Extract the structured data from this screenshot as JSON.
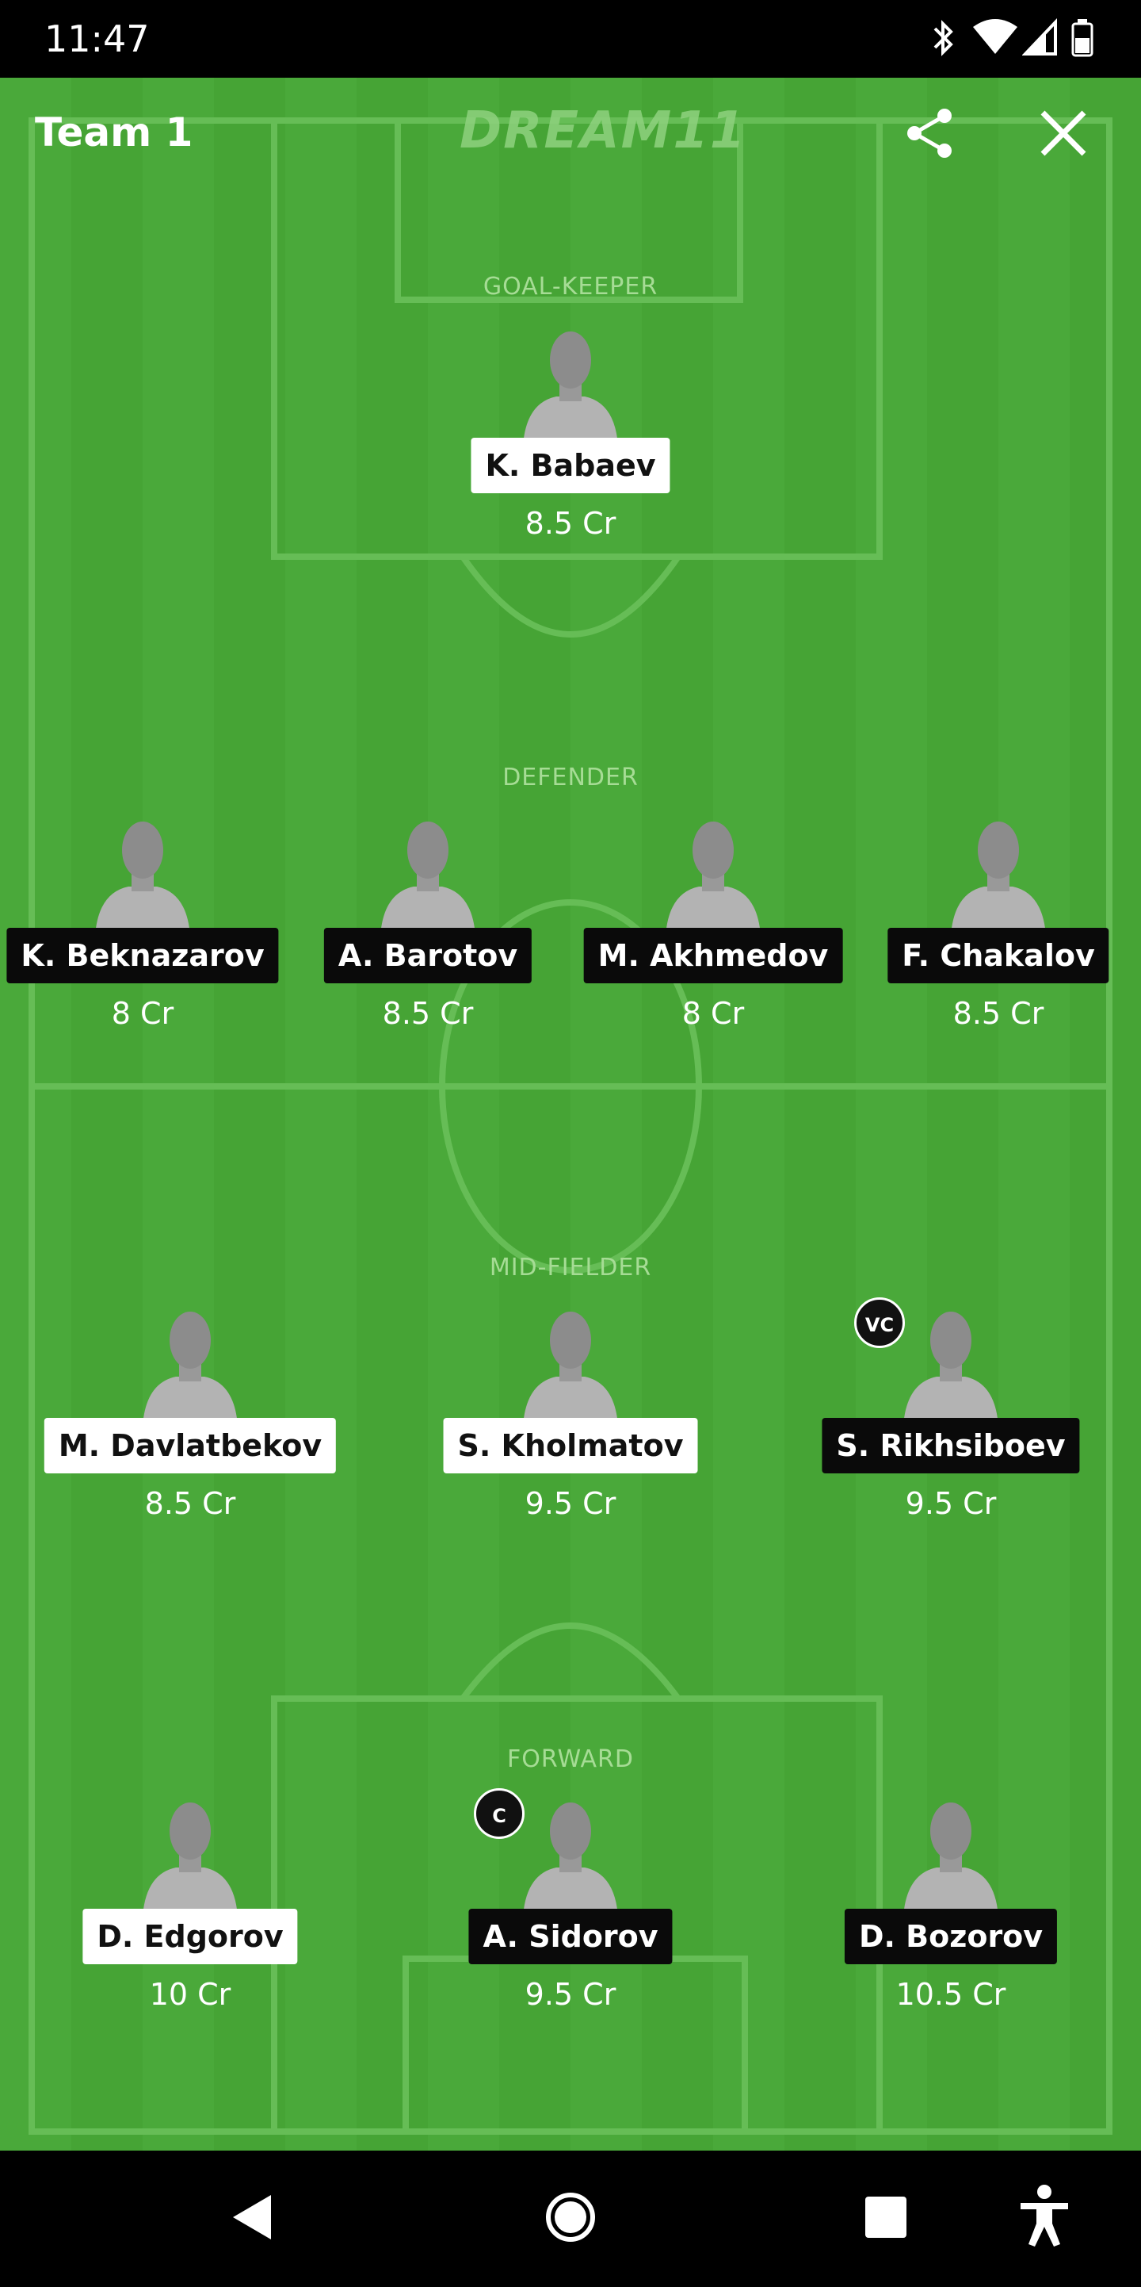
{
  "status_bar": {
    "time": "11:47"
  },
  "header": {
    "title": "Team 1",
    "brand": "DREAM11"
  },
  "sections": {
    "goalkeeper": "GOAL-KEEPER",
    "defender": "DEFENDER",
    "midfielder": "MID-FIELDER",
    "forward": "FORWARD"
  },
  "players": {
    "gk1": {
      "name": "K. Babaev",
      "credits": "8.5 Cr",
      "style": "light"
    },
    "def1": {
      "name": "K. Beknazarov",
      "credits": "8 Cr",
      "style": "dark"
    },
    "def2": {
      "name": "A. Barotov",
      "credits": "8.5 Cr",
      "style": "dark"
    },
    "def3": {
      "name": "M. Akhmedov",
      "credits": "8 Cr",
      "style": "dark"
    },
    "def4": {
      "name": "F. Chakalov",
      "credits": "8.5 Cr",
      "style": "dark"
    },
    "mid1": {
      "name": "M. Davlatbekov",
      "credits": "8.5 Cr",
      "style": "light"
    },
    "mid2": {
      "name": "S. Kholmatov",
      "credits": "9.5 Cr",
      "style": "light"
    },
    "mid3": {
      "name": "S. Rikhsiboev",
      "credits": "9.5 Cr",
      "style": "dark",
      "badge": "VC"
    },
    "fwd1": {
      "name": "D. Edgorov",
      "credits": "10 Cr",
      "style": "light"
    },
    "fwd2": {
      "name": "A. Sidorov",
      "credits": "9.5 Cr",
      "style": "dark",
      "badge": "C"
    },
    "fwd3": {
      "name": "D. Bozorov",
      "credits": "10.5 Cr",
      "style": "dark"
    }
  },
  "icons": {
    "share": "share-icon",
    "close": "close-icon",
    "back": "back-triangle-icon",
    "home": "home-circle-icon",
    "recents": "recents-square-icon",
    "accessibility": "accessibility-icon"
  },
  "colors": {
    "pitch": "#4aa93a",
    "pitch_line": "#66bd56",
    "tag_dark": "#0a0a0a",
    "tag_light": "#ffffff"
  }
}
